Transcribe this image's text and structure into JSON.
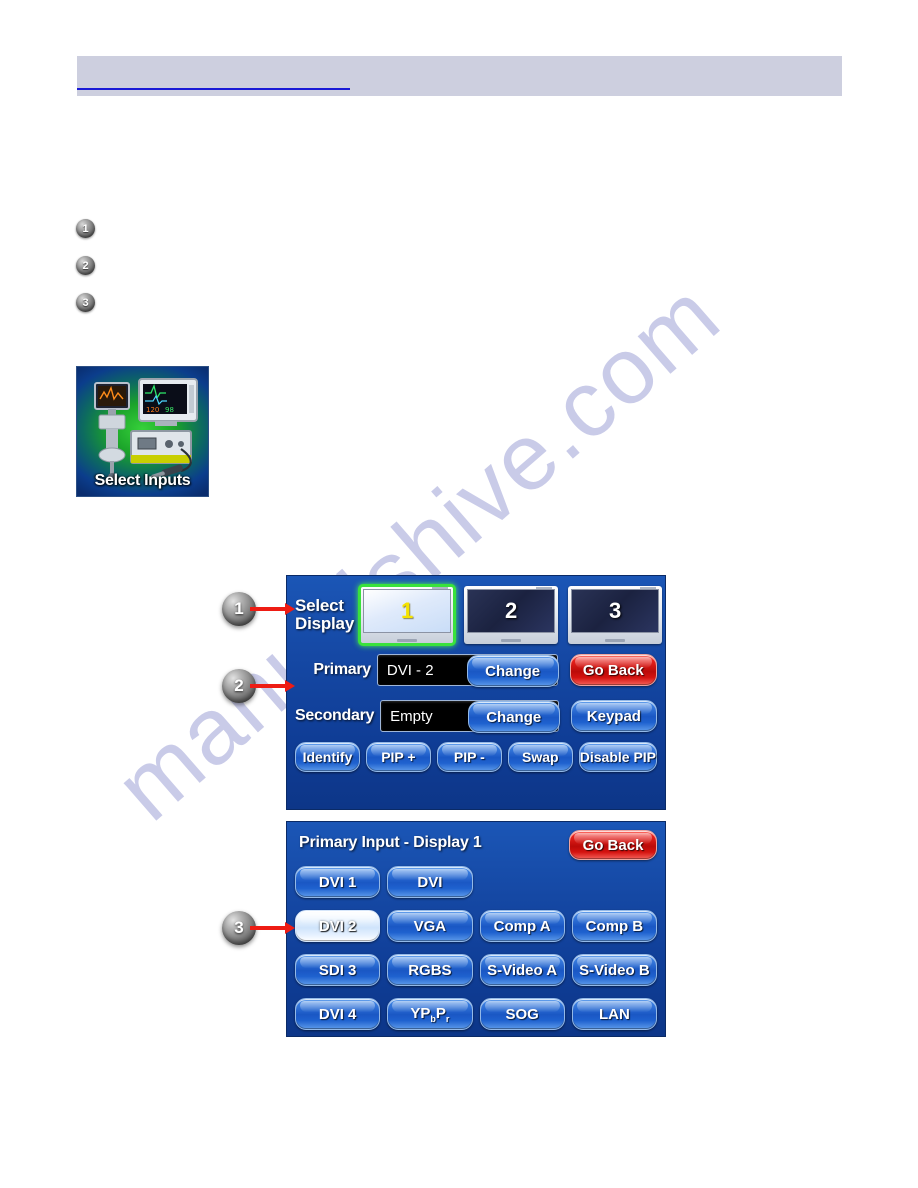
{
  "header": {
    "title": "",
    "accent_color": "#1a1ad6",
    "bar_color": "#cdcfdf"
  },
  "watermark": {
    "text": "manualshive.com"
  },
  "steps": [
    {
      "number": "1",
      "text": ""
    },
    {
      "number": "2",
      "text": ""
    },
    {
      "number": "3",
      "text": ""
    }
  ],
  "thumbnail": {
    "label": "Select Inputs"
  },
  "callouts": [
    {
      "number": "1"
    },
    {
      "number": "2"
    },
    {
      "number": "3"
    }
  ],
  "display_panel": {
    "select_display_label_line1": "Select",
    "select_display_label_line2": "Display",
    "monitors": [
      {
        "number": "1",
        "selected": true
      },
      {
        "number": "2",
        "selected": false
      },
      {
        "number": "3",
        "selected": false
      }
    ],
    "primary_label": "Primary",
    "primary_value": "DVI - 2",
    "primary_change_label": "Change",
    "go_back_label": "Go Back",
    "secondary_label": "Secondary",
    "secondary_value": "Empty",
    "secondary_change_label": "Change",
    "keypad_label": "Keypad",
    "bottom_buttons": [
      "Identify",
      "PIP +",
      "PIP -",
      "Swap",
      "Disable PIP"
    ]
  },
  "input_panel": {
    "title": "Primary Input - Display 1",
    "go_back_label": "Go Back",
    "buttons": [
      {
        "label": "DVI 1",
        "selected": false
      },
      {
        "label": "DVI",
        "selected": false
      },
      {
        "label": "",
        "selected": false,
        "empty": true
      },
      {
        "label": "",
        "selected": false,
        "empty": true
      },
      {
        "label": "DVI 2",
        "selected": true
      },
      {
        "label": "VGA",
        "selected": false
      },
      {
        "label": "Comp A",
        "selected": false
      },
      {
        "label": "Comp B",
        "selected": false
      },
      {
        "label": "SDI 3",
        "selected": false
      },
      {
        "label": "RGBS",
        "selected": false
      },
      {
        "label": "S-Video A",
        "selected": false
      },
      {
        "label": "S-Video B",
        "selected": false
      },
      {
        "label": "DVI 4",
        "selected": false
      },
      {
        "label": "YPbPr",
        "selected": false,
        "rich": "ypbpr"
      },
      {
        "label": "SOG",
        "selected": false
      },
      {
        "label": "LAN",
        "selected": false
      }
    ]
  },
  "colors": {
    "panel_blue": "#1548a4",
    "button_blue": "#3b7fe0",
    "go_back_red": "#bb0b09",
    "selected_green": "#39e23c"
  }
}
